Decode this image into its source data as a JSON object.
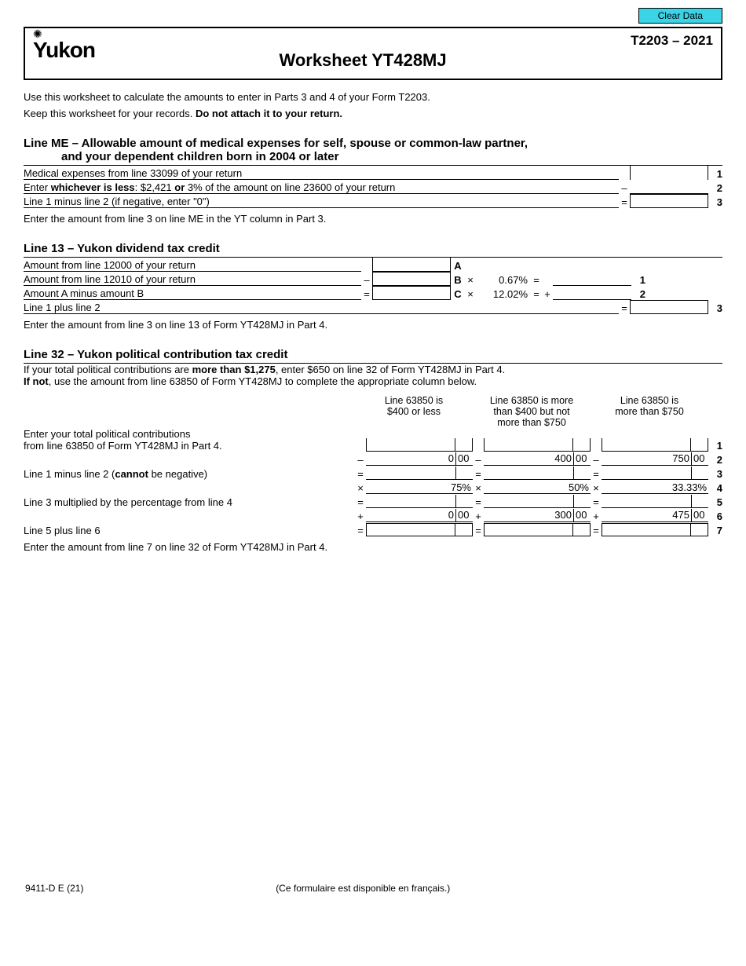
{
  "top": {
    "clear_button": "Clear Data",
    "form_id": "T2203 – 2021",
    "logo_text": "Yukon",
    "title": "Worksheet YT428MJ"
  },
  "intro": {
    "p1": "Use this worksheet to calculate the amounts to enter in Parts 3 and 4 of your Form T2203.",
    "p2_a": "Keep this worksheet for your records. ",
    "p2_b": "Do not attach it to your return."
  },
  "me": {
    "heading_a": "Line ME – Allowable amount of medical expenses for self, spouse or common-law partner,",
    "heading_b": "and your dependent children born in 2004 or later",
    "r1": "Medical expenses from line 33099 of your return",
    "r2_a": "Enter ",
    "r2_b": "whichever is less",
    "r2_c": ": $2,421 ",
    "r2_d": "or",
    "r2_e": " 3% of the amount on line 23600 of your return",
    "r3": "Line 1 minus line 2 (if negative, enter \"0\")",
    "note": "Enter the amount from line 3 on line ME in the YT column in Part 3.",
    "n1": "1",
    "n2": "2",
    "n3": "3"
  },
  "div": {
    "heading": "Line 13 – Yukon dividend tax credit",
    "r1": "Amount from line 12000 of your return",
    "r2": "Amount from line 12010 of your return",
    "r3": "Amount A minus amount B",
    "r4": "Line 1 plus line 2",
    "pct1": "0.67%",
    "pct2": "12.02%",
    "A": "A",
    "B": "B",
    "C": "C",
    "n1": "1",
    "n2": "2",
    "n3": "3",
    "note": "Enter the amount from line 3 on line 13 of Form YT428MJ in Part 4."
  },
  "pol": {
    "heading": "Line 32 – Yukon political contribution tax credit",
    "intro_a": "If your total political contributions are ",
    "intro_b": "more than $1,275",
    "intro_c": ", enter $650 on line 32 of Form YT428MJ in Part 4.",
    "intro2_a": "If not",
    "intro2_b": ", use the amount from line 63850 of Form YT428MJ to complete the appropriate column below.",
    "col1_a": "Line 63850 is",
    "col1_b": "$400 or less",
    "col2_a": "Line 63850 is more",
    "col2_b": "than $400 but not",
    "col2_c": "more than $750",
    "col3_a": "Line 63850 is",
    "col3_b": "more than $750",
    "row1_a": "Enter your total political contributions",
    "row1_b": "from line 63850 of Form YT428MJ in Part 4.",
    "row3_a": "Line 1 minus line 2 (",
    "row3_b": "cannot",
    "row3_c": " be negative)",
    "row5": "Line 3 multiplied by the percentage from line 4",
    "row7": "Line 5 plus line 6",
    "v2c1d": "0",
    "v2c1c": "00",
    "v2c2d": "400",
    "v2c2c": "00",
    "v2c3d": "750",
    "v2c3c": "00",
    "v4c1": "75%",
    "v4c2": "50%",
    "v4c3": "33.33%",
    "v6c1d": "0",
    "v6c1c": "00",
    "v6c2d": "300",
    "v6c2c": "00",
    "v6c3d": "475",
    "v6c3c": "00",
    "n1": "1",
    "n2": "2",
    "n3": "3",
    "n4": "4",
    "n5": "5",
    "n6": "6",
    "n7": "7",
    "note": "Enter the amount from line 7 on line 32 of Form YT428MJ in Part 4."
  },
  "ops": {
    "minus": "–",
    "equals": "=",
    "times": "×",
    "plus": "+"
  },
  "footer": {
    "left": "9411-D E (21)",
    "center": "(Ce formulaire est disponible en français.)"
  }
}
